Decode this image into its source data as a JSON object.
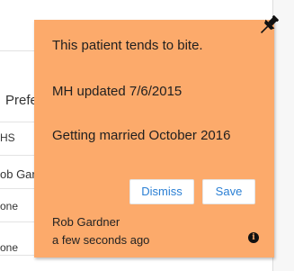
{
  "background": {
    "fragments": {
      "pref": "Prefe",
      "hs": "HS",
      "gard": "ob Gar",
      "one1": "one",
      "one2": "one"
    }
  },
  "note": {
    "color": "#fcaa6b",
    "lines": [
      "This patient tends to bite.",
      "MH updated 7/6/2015",
      "Getting married October 2016"
    ],
    "actions": {
      "dismiss_label": "Dismiss",
      "save_label": "Save"
    },
    "author": "Rob Gardner",
    "timestamp": "a few seconds ago",
    "pin_icon": "pushpin-icon",
    "info_icon": "info-icon"
  }
}
